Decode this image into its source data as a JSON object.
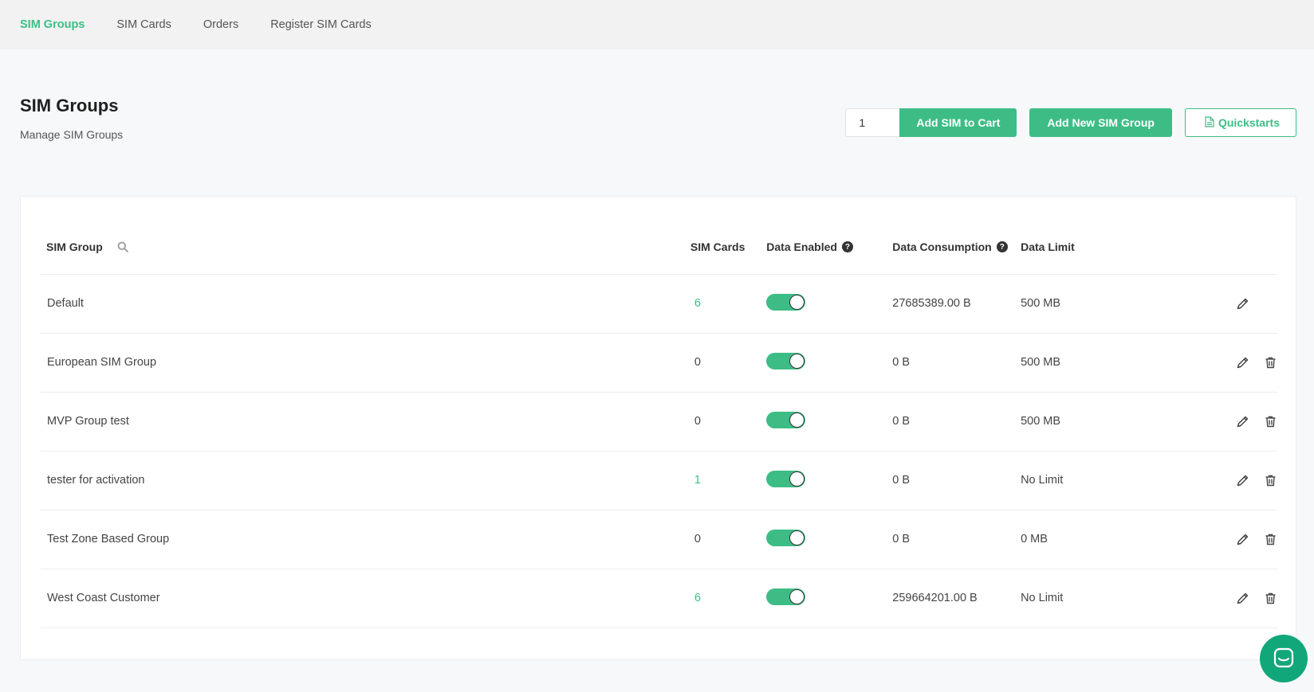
{
  "nav": {
    "items": [
      {
        "label": "SIM Groups",
        "active": true
      },
      {
        "label": "SIM Cards",
        "active": false
      },
      {
        "label": "Orders",
        "active": false
      },
      {
        "label": "Register SIM Cards",
        "active": false
      }
    ]
  },
  "header": {
    "title": "SIM Groups",
    "subtitle": "Manage SIM Groups"
  },
  "actions": {
    "quantity_value": "1",
    "add_cart_label": "Add SIM to Cart",
    "add_group_label": "Add New SIM Group",
    "quickstarts_label": "Quickstarts"
  },
  "table": {
    "columns": {
      "group": "SIM Group",
      "cards": "SIM Cards",
      "enabled": "Data Enabled",
      "consumption": "Data Consumption",
      "limit": "Data Limit"
    },
    "rows": [
      {
        "name": "Default",
        "cards": "6",
        "cards_link": true,
        "enabled": true,
        "consumption": "27685389.00 B",
        "limit": "500 MB",
        "deletable": false
      },
      {
        "name": "European SIM Group",
        "cards": "0",
        "cards_link": false,
        "enabled": true,
        "consumption": "0 B",
        "limit": "500 MB",
        "deletable": true
      },
      {
        "name": "MVP Group test",
        "cards": "0",
        "cards_link": false,
        "enabled": true,
        "consumption": "0 B",
        "limit": "500 MB",
        "deletable": true
      },
      {
        "name": "tester for activation",
        "cards": "1",
        "cards_link": true,
        "enabled": true,
        "consumption": "0 B",
        "limit": "No Limit",
        "deletable": true
      },
      {
        "name": "Test Zone Based Group",
        "cards": "0",
        "cards_link": false,
        "enabled": true,
        "consumption": "0 B",
        "limit": "0 MB",
        "deletable": true
      },
      {
        "name": "West Coast Customer",
        "cards": "6",
        "cards_link": true,
        "enabled": true,
        "consumption": "259664201.00 B",
        "limit": "No Limit",
        "deletable": true
      }
    ]
  },
  "colors": {
    "accent": "#3dbd85",
    "chat": "#12a77a"
  }
}
